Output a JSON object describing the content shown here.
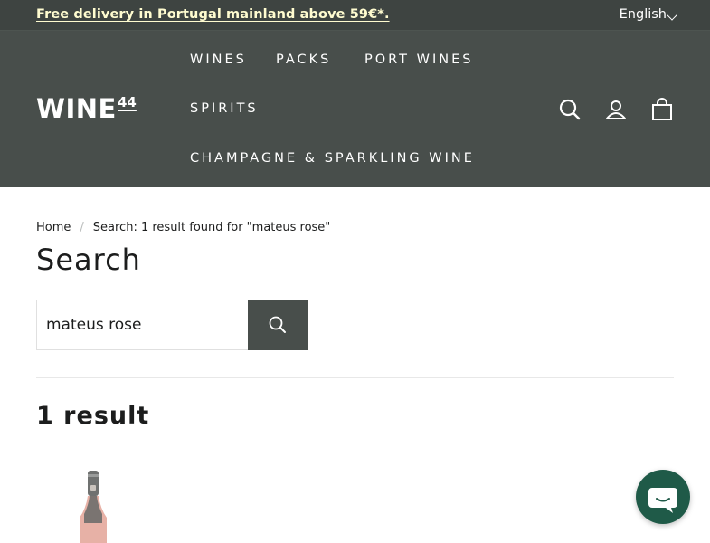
{
  "announcement": {
    "text": "Free delivery in Portugal mainland above 59€*.",
    "language": "English"
  },
  "header": {
    "logo_main": "WINE",
    "logo_num": "44",
    "nav": [
      {
        "label": "WINES"
      },
      {
        "label": "PACKS"
      },
      {
        "label": "PORT WINES"
      },
      {
        "label": "SPIRITS"
      },
      {
        "label": "CHAMPAGNE & SPARKLING WINE"
      }
    ],
    "icons": [
      "search-icon",
      "account-icon",
      "cart-icon"
    ]
  },
  "breadcrumb": {
    "home": "Home",
    "separator": "/",
    "current": "Search: 1 result found for \"mateus rose\""
  },
  "main": {
    "title": "Search",
    "search_value": "mateus rose",
    "results_count": "1 result"
  },
  "colors": {
    "announce_bg": "#3e4441",
    "header_bg": "#484e4b",
    "announce_link": "#fffcd0",
    "chat_bg": "#1f5a48"
  }
}
